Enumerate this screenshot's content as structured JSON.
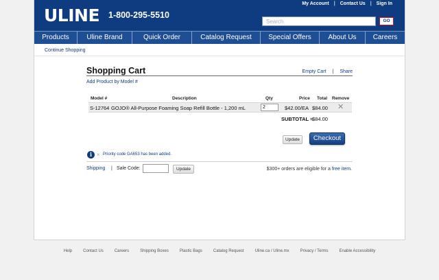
{
  "header": {
    "logo": "ULINE",
    "phone": "1-800-295-5510",
    "links": [
      "My Account",
      "Contact Us",
      "Sign In"
    ],
    "search_placeholder": "Search",
    "go_label": "GO"
  },
  "nav": [
    "Products",
    "Uline Brand",
    "Quick Order",
    "Catalog Request",
    "Special Offers",
    "About Us",
    "Careers"
  ],
  "continue_shopping": "Continue Shopping",
  "cart": {
    "title": "Shopping Cart",
    "empty_cart": "Empty Cart",
    "share": "Share",
    "add_by_model": "Add Product by Model #",
    "columns": [
      "Model #",
      "Description",
      "Qty",
      "Price",
      "Total",
      "Remove"
    ],
    "item": {
      "model": "S-12764",
      "description": "GOJO® All-Purpose Foaming Soap Refill Bottle - 1,200 mL",
      "qty": "2",
      "price": "$42.00/EA",
      "total": "$84.00",
      "remove_icon": "close-icon"
    },
    "subtotal_label": "SUBTOTAL =",
    "subtotal_value": "$84.00",
    "update_label": "Update",
    "checkout_label": "Checkout"
  },
  "info": {
    "icon": "i",
    "dismiss": "×",
    "message": "Priority code GA653 has been added."
  },
  "bottom": {
    "shipping": "Shipping",
    "sep": "|",
    "sale_code_label": "Sale Code:",
    "update_label": "Update",
    "promo_prefix": "$300+ orders are eligible for a ",
    "promo_link": "free item",
    "promo_suffix": "."
  },
  "footer": [
    "Help",
    "Contact Us",
    "Careers",
    "Shipping Boxes",
    "Plastic Bags",
    "Catalog Request",
    "Uline.ca / Uline.mx",
    "Privacy / Terms",
    "Enable Accessibility"
  ],
  "colors": {
    "brand": "#0f3c80",
    "nav": "#1e4e93",
    "go_border": "#b21f24"
  }
}
